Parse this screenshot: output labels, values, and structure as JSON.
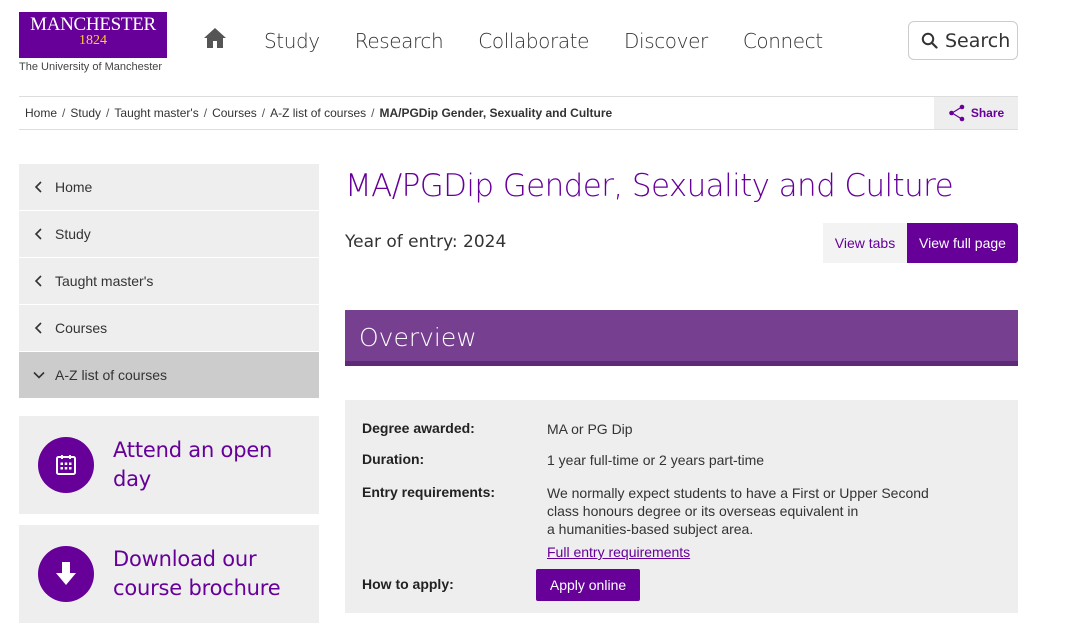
{
  "logo": {
    "name": "MANCHESTER",
    "year": "1824",
    "subtitle": "The University of Manchester"
  },
  "nav": {
    "items": [
      "Study",
      "Research",
      "Collaborate",
      "Discover",
      "Connect"
    ]
  },
  "search": {
    "label": "Search"
  },
  "breadcrumb": {
    "items": [
      "Home",
      "Study",
      "Taught master's",
      "Courses",
      "A-Z list of courses"
    ],
    "current": "MA/PGDip Gender, Sexuality and Culture"
  },
  "share": {
    "label": "Share"
  },
  "sidebar": {
    "items": [
      {
        "label": "Home",
        "icon": "chevron-left-icon"
      },
      {
        "label": "Study",
        "icon": "chevron-left-icon"
      },
      {
        "label": "Taught master's",
        "icon": "chevron-left-icon"
      },
      {
        "label": "Courses",
        "icon": "chevron-left-icon"
      },
      {
        "label": "A-Z list of courses",
        "icon": "chevron-down-icon"
      }
    ]
  },
  "promos": {
    "open_day": {
      "line1": "Attend an open",
      "line2": "day",
      "icon": "calendar-icon"
    },
    "brochure": {
      "line1": "Download our",
      "line2": "course brochure",
      "icon": "download-icon"
    }
  },
  "course": {
    "title": "MA/PGDip Gender, Sexuality and Culture",
    "year_of_entry": "Year of entry: 2024",
    "view_tabs": "View tabs",
    "view_full": "View full page"
  },
  "overview": {
    "title": "Overview",
    "degree_label": "Degree awarded:",
    "degree_value": "MA or PG Dip",
    "duration_label": "Duration:",
    "duration_value": "1 year full-time or 2 years part-time",
    "entry_label": "Entry requirements:",
    "entry_line1": "We normally expect students to have a First or Upper Second",
    "entry_line2": "class honours degree or its overseas equivalent in",
    "entry_line3": "a humanities-based subject area.",
    "entry_link": "Full entry requirements",
    "apply_label": "How to apply:",
    "apply_button": "Apply online"
  },
  "colors": {
    "brand_purple": "#660099",
    "header_purple": "#773f8f",
    "gold": "#ffcc33"
  }
}
